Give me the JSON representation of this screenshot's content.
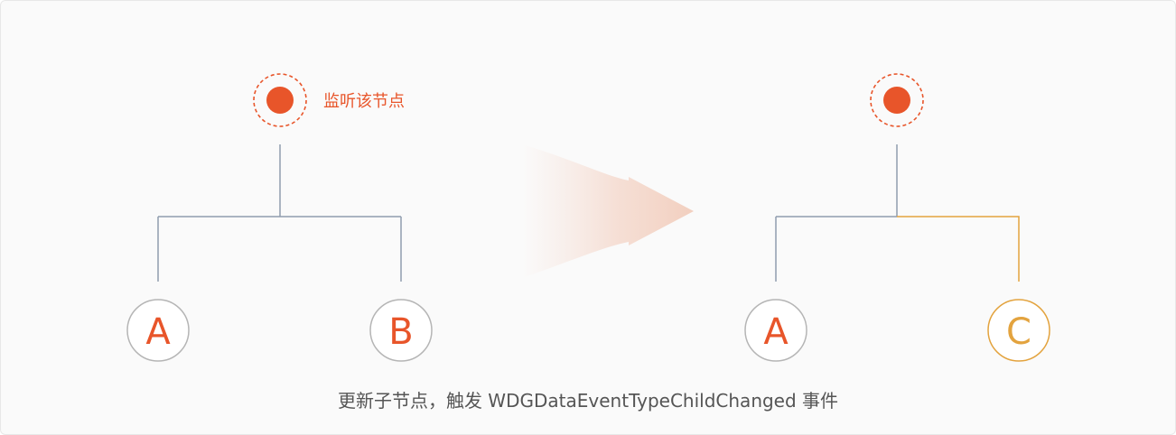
{
  "colors": {
    "accent": "#e8552a",
    "line": "#8f9cae",
    "highlight": "#e3a33e",
    "circle_border": "#b5b5b5",
    "caption": "#555555"
  },
  "before": {
    "listener_label": "监听该节点",
    "left_child": "A",
    "right_child": "B"
  },
  "after": {
    "left_child": "A",
    "right_child": "C"
  },
  "caption": "更新子节点，触发 WDGDataEventTypeChildChanged 事件"
}
